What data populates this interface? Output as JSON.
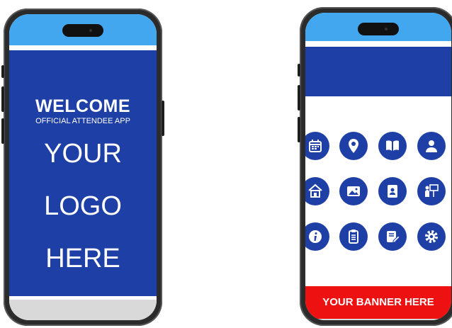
{
  "welcome_screen": {
    "title": "WELCOME",
    "subtitle": "OFFICIAL ATTENDEE APP",
    "logo_lines": [
      "YOUR",
      "LOGO",
      "HERE"
    ]
  },
  "home_screen": {
    "banner_text": "YOUR BANNER HERE",
    "icons": [
      "calendar-icon",
      "location-pin-icon",
      "book-icon",
      "user-icon",
      "home-icon",
      "image-icon",
      "contacts-icon",
      "presenter-icon",
      "info-icon",
      "clipboard-icon",
      "notes-edit-icon",
      "gear-icon"
    ]
  },
  "colors": {
    "primary_blue": "#1e3fa6",
    "light_blue": "#43a7f0",
    "banner_red": "#ee1111",
    "footer_gray": "#d9d9d9"
  }
}
